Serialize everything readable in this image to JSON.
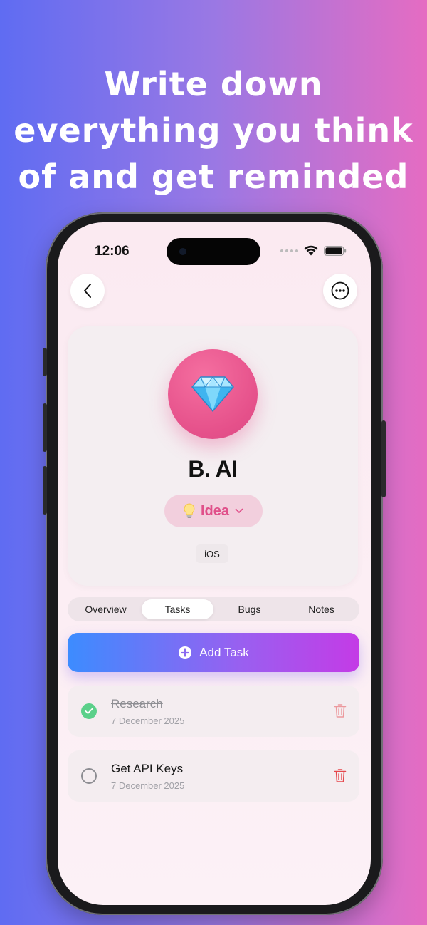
{
  "headline": {
    "line1": "Write down",
    "line2": "everything you think",
    "line3": "of and get reminded"
  },
  "status_bar": {
    "time": "12:06"
  },
  "project": {
    "name": "B. AI",
    "icon": "diamond-emoji",
    "category": {
      "label": "Idea",
      "icon": "lightbulb-emoji",
      "color": "#e0508a"
    },
    "platform_tag": "iOS"
  },
  "tabs": [
    {
      "label": "Overview",
      "active": false
    },
    {
      "label": "Tasks",
      "active": true
    },
    {
      "label": "Bugs",
      "active": false
    },
    {
      "label": "Notes",
      "active": false
    }
  ],
  "add_task": {
    "label": "Add Task"
  },
  "tasks": [
    {
      "title": "Research",
      "date": "7 December 2025",
      "completed": true
    },
    {
      "title": "Get API Keys",
      "date": "7 December 2025",
      "completed": false
    }
  ],
  "colors": {
    "accent_pink": "#e5508a",
    "done_green": "#5bd08a",
    "trash_red": "#e5484d",
    "button_gradient_start": "#3c8cff",
    "button_gradient_end": "#c43be6"
  }
}
